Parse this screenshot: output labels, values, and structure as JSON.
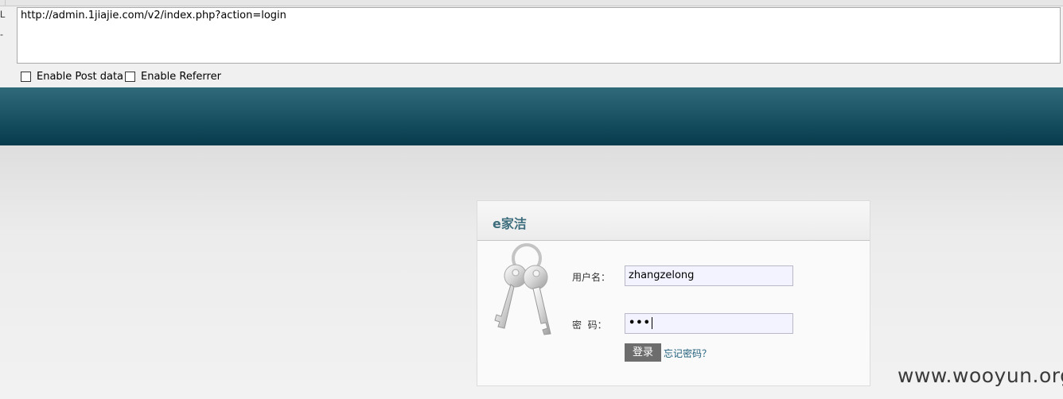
{
  "toolbar": {
    "side_marks": [
      "L",
      "-"
    ],
    "url_value": "http://admin.1jiajie.com/v2/index.php?action=login",
    "options": [
      {
        "label": "Enable Post data",
        "checked": false
      },
      {
        "label": "Enable Referrer",
        "checked": false
      }
    ]
  },
  "colors": {
    "banner_dark": "#053a4b",
    "banner_light": "#2f6a7b",
    "title": "#3e6e7d",
    "button": "#6d6d6d",
    "link": "#1e5e7a"
  },
  "login": {
    "title": "e家洁",
    "icon": "keys-icon",
    "username_label": "用户名：",
    "username_value": "zhangzelong",
    "password_label": "密  码：",
    "password_value": "•••",
    "submit_label": "登录",
    "forgot_label": "忘记密码？"
  },
  "watermark": "www.wooyun.org"
}
